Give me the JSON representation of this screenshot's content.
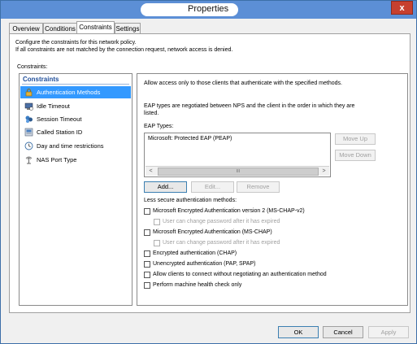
{
  "window": {
    "title": "Properties",
    "close_glyph": "x"
  },
  "tabs": [
    {
      "label": "Overview",
      "active": false
    },
    {
      "label": "Conditions",
      "active": false
    },
    {
      "label": "Constraints",
      "active": true
    },
    {
      "label": "Settings",
      "active": false
    }
  ],
  "intro": {
    "line1": "Configure the constraints for this network policy.",
    "line2": "If all constraints are not matched by the connection request, network access is denied."
  },
  "constraints_label": "Constraints:",
  "constraints_list": {
    "header": "Constraints",
    "items": [
      {
        "label": "Authentication Methods",
        "icon": "lock-key-icon",
        "selected": true
      },
      {
        "label": "Idle Timeout",
        "icon": "idle-timeout-icon",
        "selected": false
      },
      {
        "label": "Session Timeout",
        "icon": "session-timeout-icon",
        "selected": false
      },
      {
        "label": "Called Station ID",
        "icon": "called-station-icon",
        "selected": false
      },
      {
        "label": "Day and time restrictions",
        "icon": "clock-icon",
        "selected": false
      },
      {
        "label": "NAS Port Type",
        "icon": "nas-port-icon",
        "selected": false
      }
    ]
  },
  "auth_methods": {
    "description": "Allow access only to those clients that authenticate with the specified methods.",
    "eap_note_line1": "EAP types are negotiated between NPS and the client in the order in which they are",
    "eap_note_line2": "listed.",
    "eap_types_label": "EAP Types:",
    "eap_types": [
      "Microsoft: Protected EAP (PEAP)"
    ],
    "scroll_grip": "III",
    "buttons": {
      "move_up": "Move Up",
      "move_down": "Move Down",
      "add": "Add...",
      "edit": "Edit...",
      "remove": "Remove"
    },
    "less_secure_label": "Less secure authentication methods:",
    "options": [
      {
        "label": "Microsoft Encrypted Authentication version 2 (MS-CHAP-v2)",
        "checked": false,
        "disabled": false,
        "indent": false
      },
      {
        "label": "User can change password after it has expired",
        "checked": false,
        "disabled": true,
        "indent": true
      },
      {
        "label": "Microsoft Encrypted Authentication (MS-CHAP)",
        "checked": false,
        "disabled": false,
        "indent": false
      },
      {
        "label": "User can change password after it has expired",
        "checked": false,
        "disabled": true,
        "indent": true
      },
      {
        "label": "Encrypted authentication (CHAP)",
        "checked": false,
        "disabled": false,
        "indent": false
      },
      {
        "label": "Unencrypted authentication (PAP, SPAP)",
        "checked": false,
        "disabled": false,
        "indent": false
      },
      {
        "label": "Allow clients to connect without negotiating an authentication method",
        "checked": false,
        "disabled": false,
        "indent": false
      },
      {
        "label": "Perform machine health check only",
        "checked": false,
        "disabled": false,
        "indent": false
      }
    ]
  },
  "footer": {
    "ok": "OK",
    "cancel": "Cancel",
    "apply": "Apply"
  }
}
